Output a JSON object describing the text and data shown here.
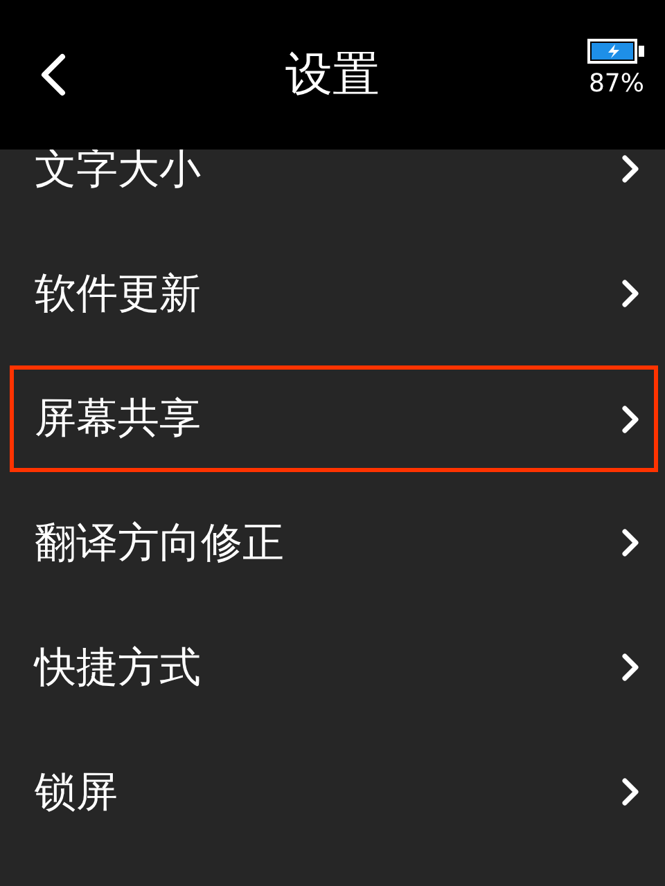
{
  "header": {
    "title": "设置",
    "battery": "87%"
  },
  "items": [
    {
      "label": "文字大小",
      "selected": false
    },
    {
      "label": "软件更新",
      "selected": false
    },
    {
      "label": "屏幕共享",
      "selected": true
    },
    {
      "label": "翻译方向修正",
      "selected": false
    },
    {
      "label": "快捷方式",
      "selected": false
    },
    {
      "label": "锁屏",
      "selected": false
    }
  ]
}
